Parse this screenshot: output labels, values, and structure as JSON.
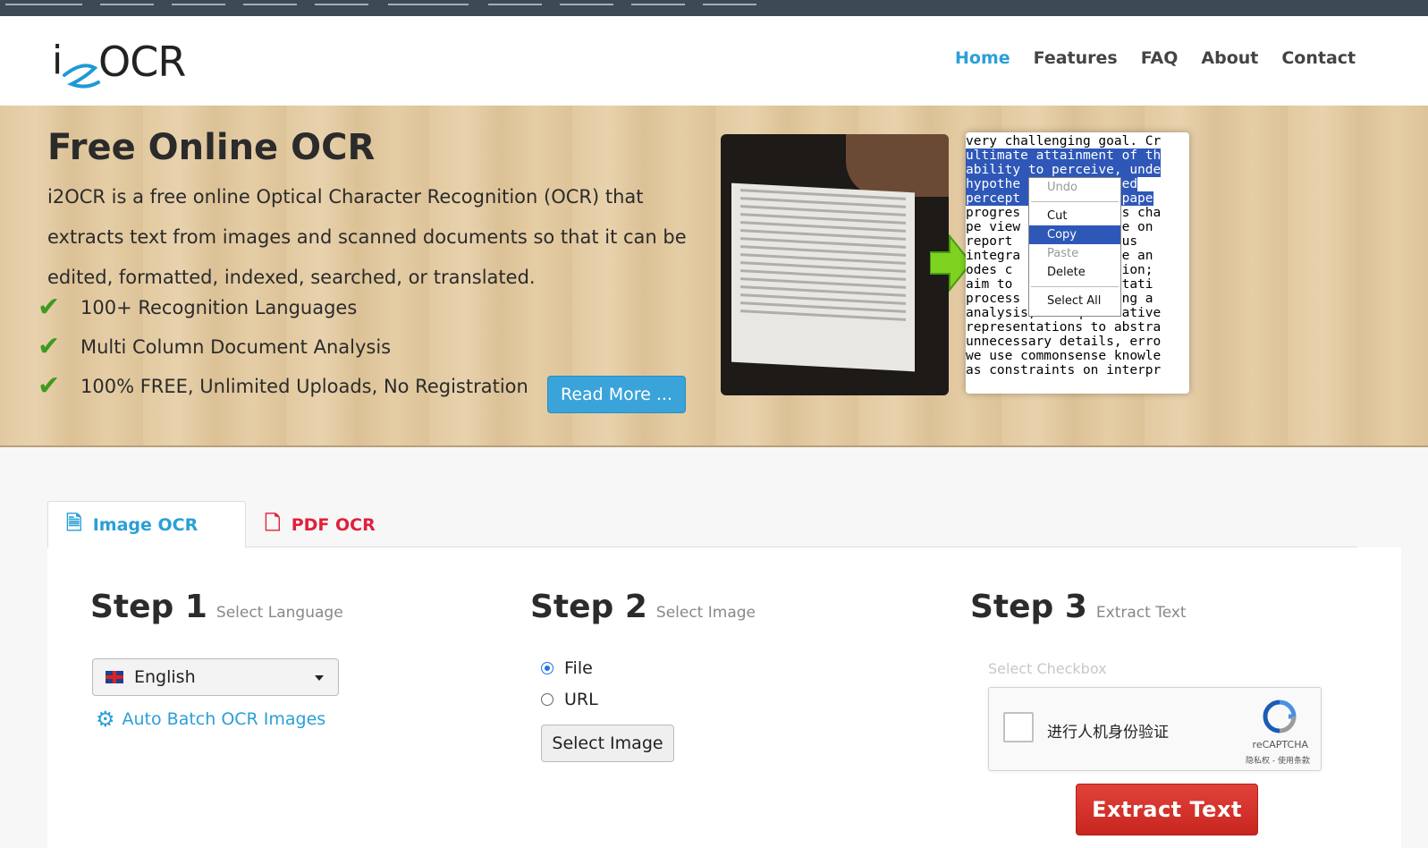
{
  "nav": {
    "items": [
      "Home",
      "Features",
      "FAQ",
      "About",
      "Contact"
    ],
    "active": "Home"
  },
  "logo": {
    "text_i": "i",
    "text_ocr": "OCR"
  },
  "hero": {
    "title": "Free Online OCR",
    "description": "i2OCR is a free online Optical Character Recognition (OCR) that extracts text from images and scanned documents so that it can be edited, formatted, indexed, searched, or translated.",
    "features": [
      "100+ Recognition Languages",
      "Multi Column Document Analysis",
      "100% FREE, Unlimited Uploads, No Registration"
    ],
    "read_more": "Read More ...",
    "context_menu": [
      "Undo",
      "Cut",
      "Copy",
      "Paste",
      "Delete",
      "Select All"
    ],
    "sample_text": [
      "very challenging goal. Cr",
      "ultimate attainment of th",
      "ability to perceive, unde",
      "hypothe          based",
      "percept          is pape",
      "progres          this cha",
      "pe view          date on",
      "report           focus",
      "integra          tive an",
      "odes c           tation;",
      "aim to           ntitati",
      "process          cking a",
      "analysis, and qualitative",
      "representations to abstra",
      "unnecessary details, erro",
      "we use commonsense knowle",
      "as constraints on interpr"
    ]
  },
  "tabs": {
    "image_ocr": "Image OCR",
    "pdf_ocr": "PDF OCR"
  },
  "step1": {
    "title": "Step 1",
    "subtitle": "Select Language",
    "language": "English",
    "batch_link": "Auto Batch OCR Images"
  },
  "step2": {
    "title": "Step 2",
    "subtitle": "Select Image",
    "option_file": "File",
    "option_url": "URL",
    "selected": "File",
    "select_button": "Select Image"
  },
  "step3": {
    "title": "Step 3",
    "subtitle": "Extract Text",
    "checkbox_label": "Select Checkbox",
    "recaptcha_text": "进行人机身份验证",
    "recaptcha_brand": "reCAPTCHA",
    "recaptcha_terms": "隐私权 - 使用条款",
    "extract_button": "Extract Text"
  },
  "colors": {
    "accent": "#2a9fd8",
    "pdf_red": "#e0203c",
    "extract_red": "#d3332b",
    "check_green": "#3f9a1f"
  }
}
